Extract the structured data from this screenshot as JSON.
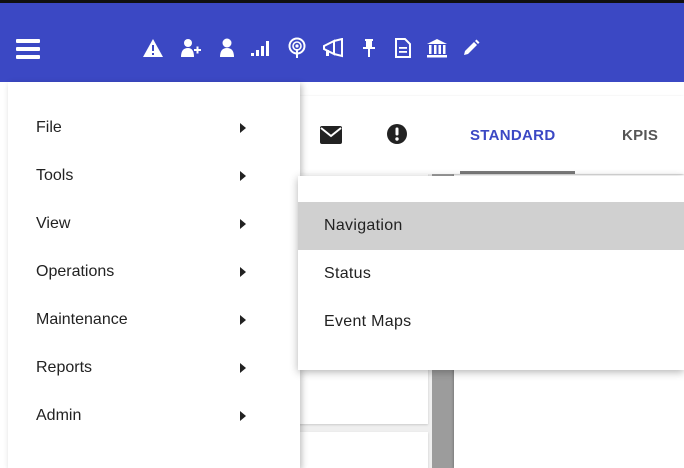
{
  "topbar": {
    "color": "#3b48c4",
    "icons": [
      "warning-icon",
      "add-user-icon",
      "user-icon",
      "signal-icon",
      "podcast-icon",
      "megaphone-icon",
      "pushpin-icon",
      "document-icon",
      "bank-icon",
      "pencil-icon"
    ]
  },
  "toolbar": {
    "icons": [
      "envelope-icon",
      "alert-circle-icon"
    ]
  },
  "tabs": [
    {
      "label": "STANDARD",
      "active": true
    },
    {
      "label": "KPIS",
      "active": false
    }
  ],
  "menu": {
    "items": [
      {
        "label": "File"
      },
      {
        "label": "Tools"
      },
      {
        "label": "View"
      },
      {
        "label": "Operations"
      },
      {
        "label": "Maintenance"
      },
      {
        "label": "Reports"
      },
      {
        "label": "Admin"
      }
    ]
  },
  "submenu": {
    "parent": "View",
    "items": [
      {
        "label": "Navigation",
        "highlighted": true
      },
      {
        "label": "Status",
        "highlighted": false
      },
      {
        "label": "Event Maps",
        "highlighted": false
      }
    ]
  }
}
